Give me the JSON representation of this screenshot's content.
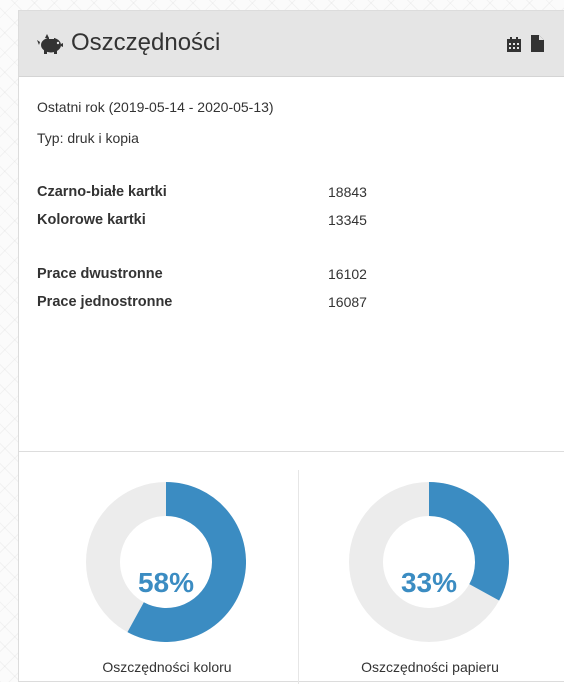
{
  "colors": {
    "accent": "#3b8cc2",
    "track": "#ececec",
    "header_bg": "#e5e5e5",
    "text": "#333333"
  },
  "header": {
    "title": "Oszczędności",
    "icon": "piggy-bank-icon",
    "actions": [
      "calendar-icon",
      "document-icon"
    ]
  },
  "summary": {
    "period": "Ostatni rok (2019-05-14 - 2020-05-13)",
    "type": "Typ: druk i kopia"
  },
  "stats": {
    "bw_label": "Czarno-białe kartki",
    "bw_value": "18843",
    "color_label": "Kolorowe kartki",
    "color_value": "13345",
    "duplex_label": "Prace dwustronne",
    "duplex_value": "16102",
    "simplex_label": "Prace jednostronne",
    "simplex_value": "16087"
  },
  "gauges": [
    {
      "label": "Oszczędności koloru",
      "percent_text": "58%",
      "fraction": 0.58
    },
    {
      "label": "Oszczędności papieru",
      "percent_text": "33%",
      "fraction": 0.33
    }
  ]
}
